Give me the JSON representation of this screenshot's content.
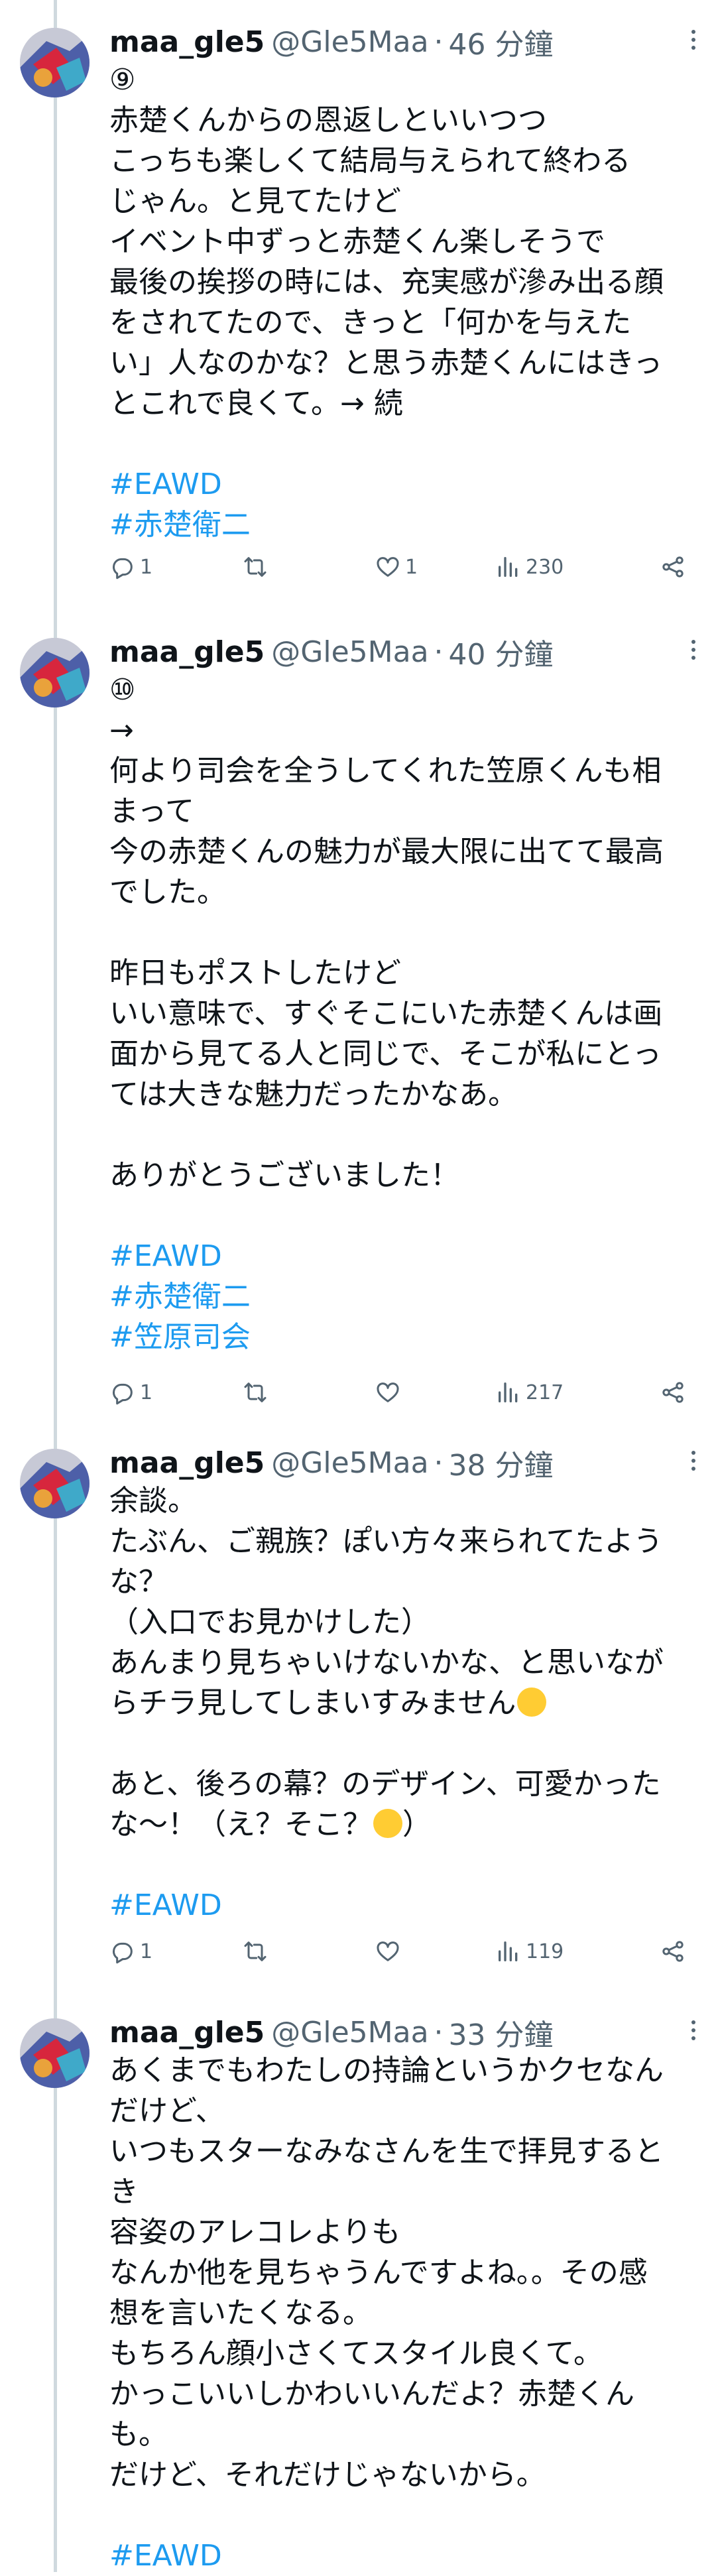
{
  "colors": {
    "text": "#0f1419",
    "muted": "#536471",
    "link": "#1d9bf0",
    "thread_line": "#cfd9de",
    "background": "#ffffff"
  },
  "icons": [
    "reply-icon",
    "retweet-icon",
    "like-icon",
    "views-icon",
    "share-icon",
    "more-icon"
  ],
  "tweets": [
    {
      "name": "maa_gle5",
      "handle": "@Gle5Maa",
      "separator": "·",
      "time": "46 分鐘",
      "lines": [
        "⑨",
        "赤楚くんからの恩返しといいつつ",
        "こっちも楽しくて結局与えられて終わる",
        "じゃん。と見てたけど",
        "イベント中ずっと赤楚くん楽しそうで",
        "最後の挨拶の時には、充実感が滲み出る顔",
        "をされてたので、きっと「何かを与えた",
        "い」人なのかな？と思う赤楚くんにはきっ",
        "とこれで良くて。→ 続"
      ],
      "hashtags": [
        "#EAWD",
        "#赤楚衛二"
      ],
      "replies": "1",
      "retweets": "",
      "likes": "1",
      "views": "230"
    },
    {
      "name": "maa_gle5",
      "handle": "@Gle5Maa",
      "separator": "·",
      "time": "40 分鐘",
      "lines": [
        "⑩",
        "→",
        "何より司会を全うしてくれた笠原くんも相",
        "まって",
        "今の赤楚くんの魅力が最大限に出てて最高",
        "でした。",
        "",
        "昨日もポストしたけど",
        "いい意味で、すぐそこにいた赤楚くんは画",
        "面から見てる人と同じで、そこが私にとっ",
        "ては大きな魅力だったかなあ。",
        "",
        "ありがとうございました！"
      ],
      "hashtags": [
        "#EAWD",
        "#赤楚衛二",
        "#笠原司会"
      ],
      "replies": "1",
      "retweets": "",
      "likes": "",
      "views": "217"
    },
    {
      "name": "maa_gle5",
      "handle": "@Gle5Maa",
      "separator": "·",
      "time": "38 分鐘",
      "lines": [
        "余談。",
        "たぶん、ご親族？ぽい方々来られてたよう",
        "な？",
        "（入口でお見かけした）",
        "あんまり見ちゃいけないかな、と思いなが",
        "らチラ見してしまいすみません",
        "",
        "あと、後ろの幕？のデザイン、可愛かった",
        "な〜！（え？そこ？"
      ],
      "emoji_after": {
        "5": "face-with-open-mouth-emoji",
        "8": "joy-emoji"
      },
      "line_suffix": {
        "8": "）"
      },
      "hashtags": [
        "#EAWD"
      ],
      "replies": "1",
      "retweets": "",
      "likes": "",
      "views": "119"
    },
    {
      "name": "maa_gle5",
      "handle": "@Gle5Maa",
      "separator": "·",
      "time": "33 分鐘",
      "lines": [
        "あくまでもわたしの持論というかクセなん",
        "だけど、",
        "いつもスターなみなさんを生で拝見すると",
        "き",
        "容姿のアレコレよりも",
        "なんか他を見ちゃうんですよね。。その感",
        "想を言いたくなる。",
        "もちろん顔小さくてスタイル良くて。",
        "かっこいいしかわいいんだよ？赤楚くん",
        "も。",
        "だけど、それだけじゃないから。"
      ],
      "hashtags": [
        "#EAWD"
      ]
    }
  ]
}
